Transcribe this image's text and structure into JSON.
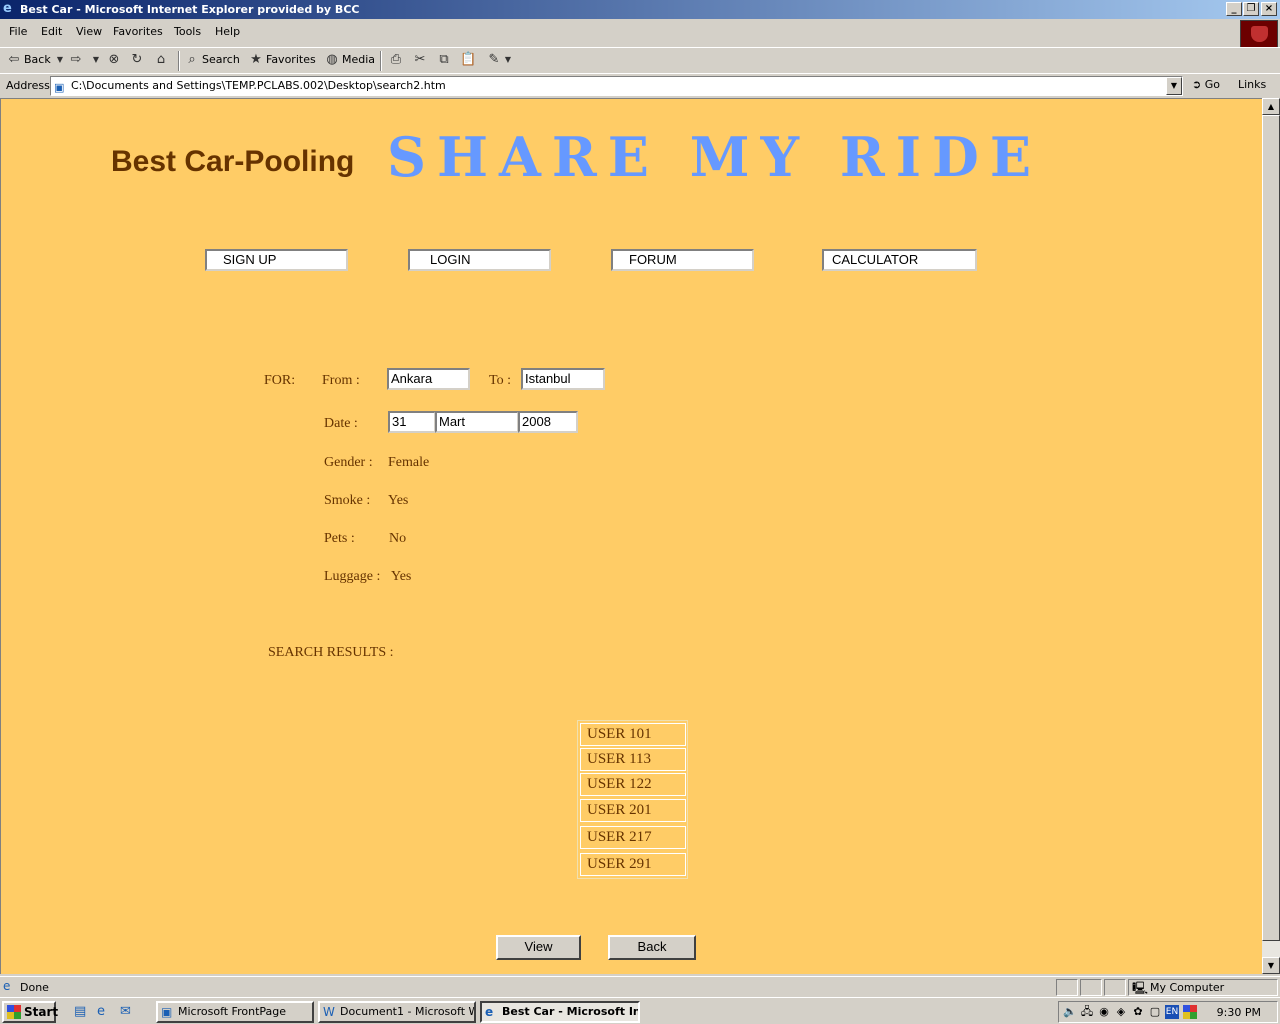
{
  "window": {
    "title": "Best Car - Microsoft Internet Explorer provided by BCC"
  },
  "menu": [
    "File",
    "Edit",
    "View",
    "Favorites",
    "Tools",
    "Help"
  ],
  "toolbar": {
    "back": "Back",
    "search": "Search",
    "favorites": "Favorites",
    "media": "Media"
  },
  "address": {
    "label": "Address",
    "url": "C:\\Documents and Settings\\TEMP.PCLABS.002\\Desktop\\search2.htm",
    "go": "Go",
    "links": "Links"
  },
  "page": {
    "brand": "Best Car-Pooling",
    "headline": "SHARE MY RIDE",
    "nav": [
      "SIGN UP",
      "LOGIN",
      "FORUM",
      "CALCULATOR"
    ],
    "for_label": "FOR:",
    "from_label": "From :",
    "from_value": "Ankara",
    "to_label": "To :",
    "to_value": "Istanbul",
    "date_label": "Date :",
    "date_day": "31",
    "date_month": "Mart",
    "date_year": "2008",
    "gender_label": "Gender :",
    "gender_value": "Female",
    "smoke_label": "Smoke :",
    "smoke_value": "Yes",
    "pets_label": "Pets :",
    "pets_value": "No",
    "luggage_label": "Luggage :",
    "luggage_value": "Yes",
    "results_label": "SEARCH RESULTS :",
    "results": [
      "USER 101",
      "USER 113",
      "USER 122",
      "USER 201",
      "USER 217",
      "USER 291"
    ],
    "view_button": "View",
    "back_button": "Back"
  },
  "status": {
    "text": "Done",
    "zone": "My Computer"
  },
  "taskbar": {
    "start": "Start",
    "tasks": [
      "Microsoft FrontPage",
      "Document1 - Microsoft W...",
      "Best Car - Microsoft In..."
    ],
    "lang": "EN",
    "clock": "9:30 PM"
  },
  "colors": {
    "page_bg": "#ffcc66",
    "brand": "#663300",
    "headline": "#6699ff"
  }
}
